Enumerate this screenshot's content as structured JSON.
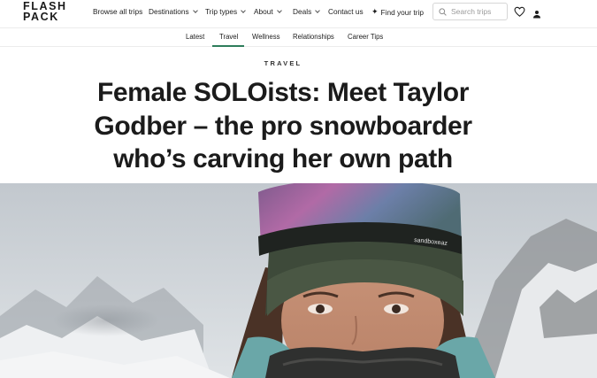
{
  "brand": {
    "line1": "FLASH",
    "line2": "PACK"
  },
  "nav": {
    "items": [
      {
        "label": "Browse all trips",
        "dropdown": false
      },
      {
        "label": "Destinations",
        "dropdown": true
      },
      {
        "label": "Trip types",
        "dropdown": true
      },
      {
        "label": "About",
        "dropdown": true
      },
      {
        "label": "Deals",
        "dropdown": true
      },
      {
        "label": "Contact us",
        "dropdown": false
      }
    ],
    "find_trip": "Find your trip",
    "search_placeholder": "Search trips"
  },
  "categories": {
    "items": [
      "Latest",
      "Travel",
      "Wellness",
      "Relationships",
      "Career Tips"
    ],
    "active": "Travel"
  },
  "article": {
    "kicker": "TRAVEL",
    "title": "Female SOLOists: Meet Taylor Godber – the pro snowboarder who’s carving her own path",
    "goggle_brand": "sandboxeaz"
  },
  "colors": {
    "accent": "#2e7d5b",
    "text": "#1b1b1b"
  },
  "icons": [
    "sparkle-icon",
    "search-icon",
    "heart-icon",
    "user-icon"
  ]
}
